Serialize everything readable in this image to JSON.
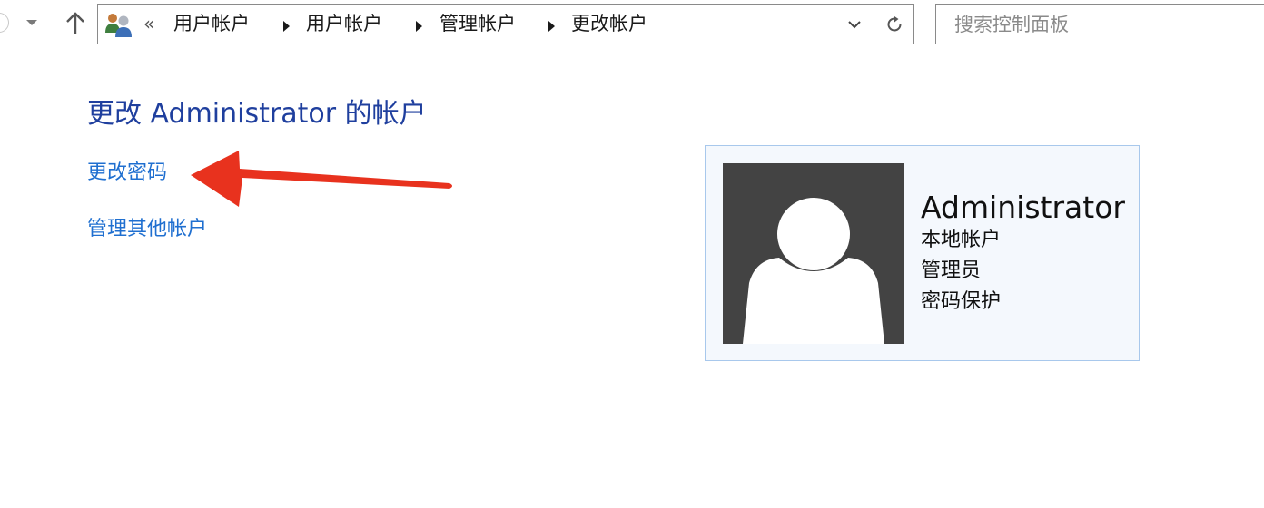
{
  "navigation": {
    "breadcrumb_overflow": "«",
    "breadcrumbs": [
      {
        "label": "用户帐户"
      },
      {
        "label": "用户帐户"
      },
      {
        "label": "管理帐户"
      },
      {
        "label": "更改帐户"
      }
    ],
    "icons": {
      "back": "back-circle-icon",
      "recent": "chevron-down-icon",
      "up": "up-arrow-icon",
      "location": "users-icon",
      "address_dropdown": "chevron-down-icon",
      "refresh": "refresh-icon"
    }
  },
  "search": {
    "placeholder": "搜索控制面板",
    "value": ""
  },
  "main": {
    "title": "更改 Administrator 的帐户",
    "links": [
      {
        "label": "更改密码"
      },
      {
        "label": "管理其他帐户"
      }
    ]
  },
  "account": {
    "name": "Administrator",
    "type": "本地帐户",
    "role": "管理员",
    "protection": "密码保护"
  },
  "colors": {
    "title": "#1f3f9e",
    "link": "#1f6fd0",
    "card_border": "#a8c8ec",
    "card_background": "#f4f8fd",
    "avatar_background": "#434343",
    "annotation_arrow": "#e8321e"
  }
}
